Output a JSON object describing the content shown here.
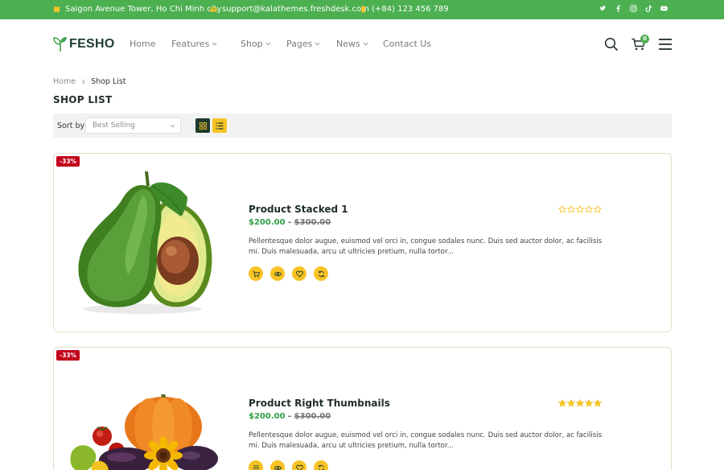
{
  "topbar": {
    "address": "Saigon Avenue Tower, Ho Chi Minh city",
    "email": "support@kalathemes.freshdesk.com",
    "phone": "(+84) 123 456 789",
    "social_icons": [
      "twitter-icon",
      "facebook-icon",
      "instagram-icon",
      "tiktok-icon",
      "youtube-icon"
    ]
  },
  "header": {
    "brand": "FESHO",
    "nav": [
      {
        "label": "Home",
        "dropdown": false
      },
      {
        "label": "Features",
        "dropdown": true
      },
      {
        "label": "Shop",
        "dropdown": true
      },
      {
        "label": "Pages",
        "dropdown": true
      },
      {
        "label": "News",
        "dropdown": true
      },
      {
        "label": "Contact Us",
        "dropdown": false
      }
    ],
    "cart_count": "0",
    "icons": [
      "search-icon",
      "cart-icon",
      "menu-icon"
    ]
  },
  "breadcrumb": {
    "home": "Home",
    "current": "Shop List"
  },
  "page_title": "SHOP LIST",
  "toolbar": {
    "sort_label": "Sort by",
    "sort_value": "Best Selling",
    "views": [
      "grid-view-icon",
      "list-view-icon"
    ],
    "active_view": "list"
  },
  "products": [
    {
      "badge": "-33%",
      "name": "Product Stacked 1",
      "price": "$200.00",
      "separator": "-",
      "old_price": "$300.00",
      "rating": 0,
      "rating_max": 5,
      "description": "Pellentesque dolor augue, euismod vel orci in, congue sodales nunc. Duis sed auctor dolor, ac facilisis mi. Duis malesuada, arcu ut ultricies pretium, nulla tortor...",
      "image": "avocado",
      "actions": [
        "cart-icon",
        "quick-view-icon",
        "wishlist-icon",
        "compare-icon"
      ]
    },
    {
      "badge": "-33%",
      "name": "Product Right Thumbnails",
      "price": "$200.00",
      "separator": "-",
      "old_price": "$300.00",
      "rating": 5,
      "rating_max": 5,
      "description": "Pellentesque dolor augue, euismod vel orci in, congue sodales nunc. Duis sed auctor dolor, ac facilisis mi. Duis malesuada, arcu ut ultricies pretium, nulla tortor...",
      "image": "pumpkin-and-vegetables",
      "actions": [
        "list-icon",
        "quick-view-icon",
        "wishlist-icon",
        "compare-icon"
      ]
    }
  ],
  "colors": {
    "brand_green": "#4caf50",
    "price_green": "#2e9e47",
    "badge_red": "#c4001a",
    "accent_yellow": "#f7c325",
    "grid_view_dark": "#1f3b2f"
  }
}
